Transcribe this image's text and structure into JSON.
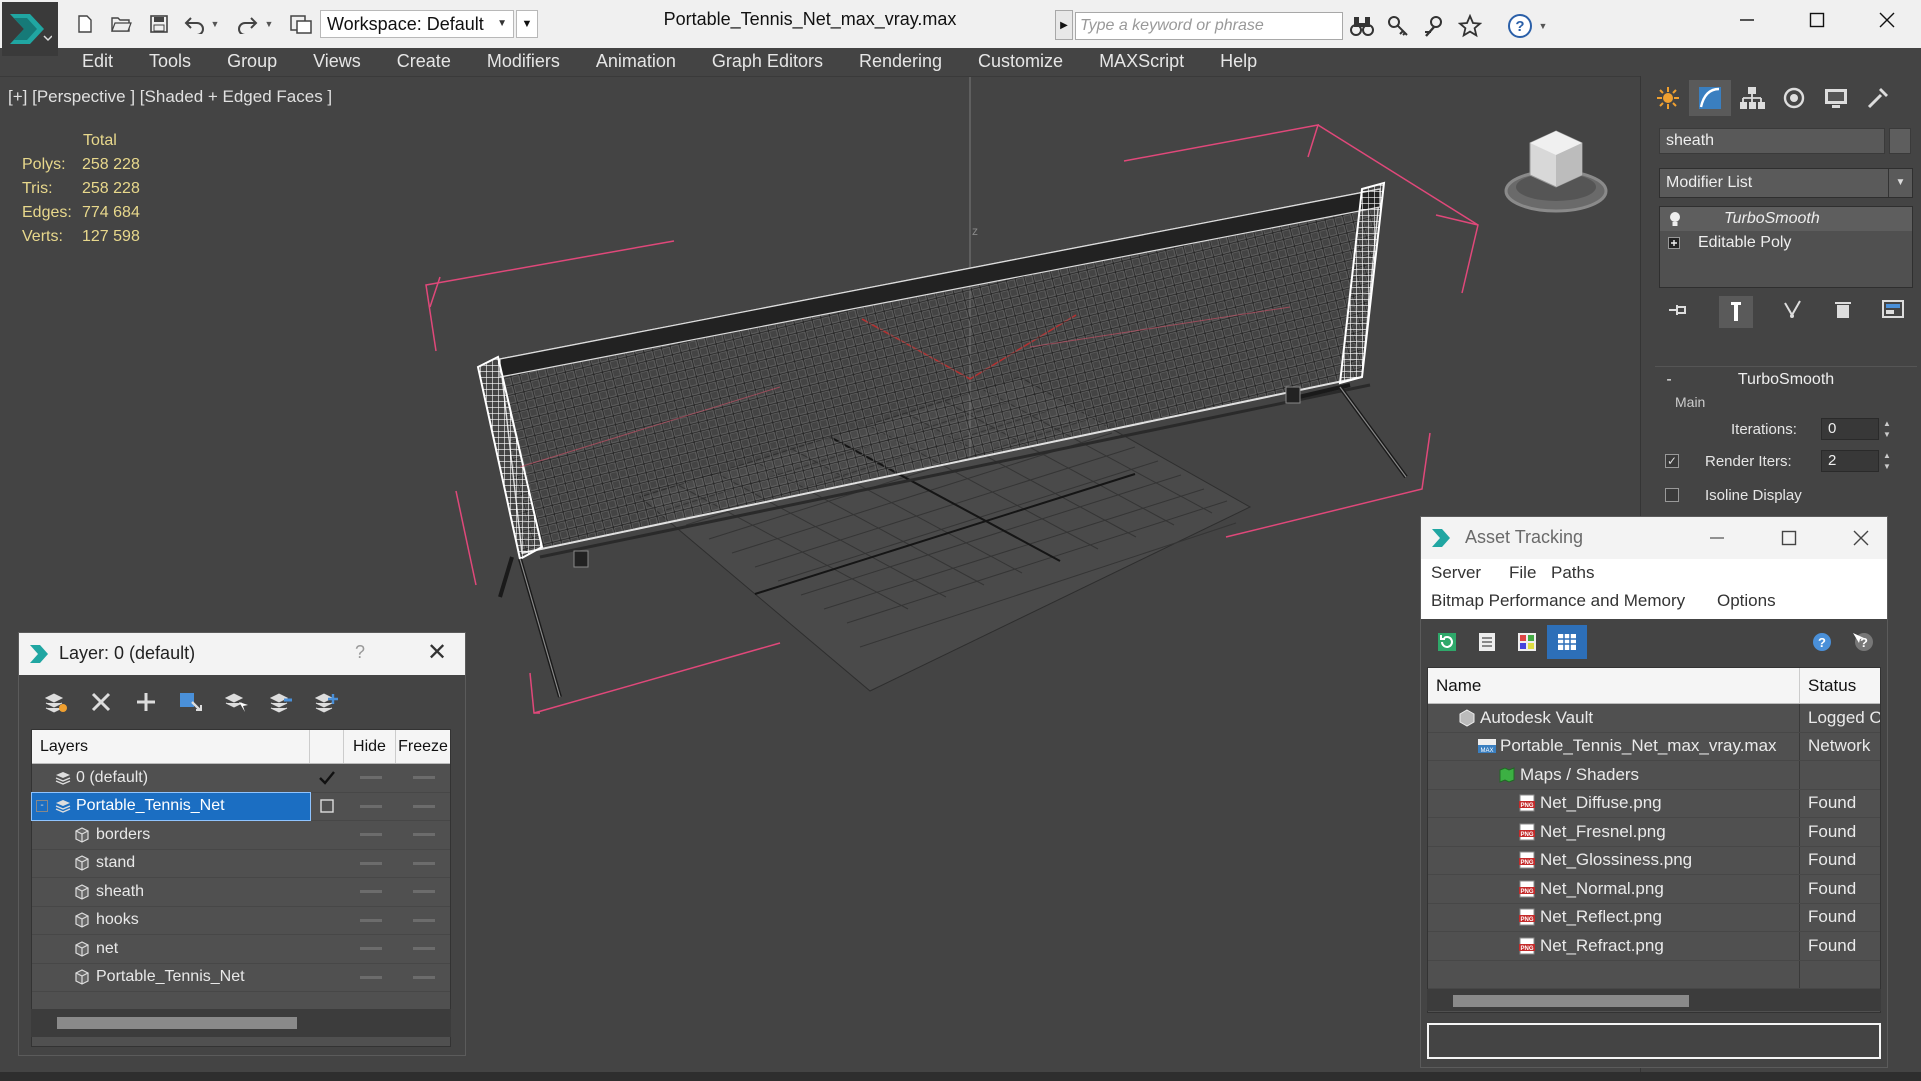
{
  "title_bar": {
    "window_title": "Portable_Tennis_Net_max_vray.max",
    "workspace_label": "Workspace: Default",
    "search_placeholder": "Type a keyword or phrase"
  },
  "menu": {
    "items": [
      "Edit",
      "Tools",
      "Group",
      "Views",
      "Create",
      "Modifiers",
      "Animation",
      "Graph Editors",
      "Rendering",
      "Customize",
      "MAXScript",
      "Help"
    ]
  },
  "viewport": {
    "label": "[+] [Perspective ] [Shaded + Edged Faces ]",
    "stats": {
      "header": "Total",
      "rows": [
        {
          "label": "Polys:",
          "value": "258 228"
        },
        {
          "label": "Tris:",
          "value": "258 228"
        },
        {
          "label": "Edges:",
          "value": "774 684"
        },
        {
          "label": "Verts:",
          "value": "127 598"
        }
      ]
    },
    "axis_label": "z",
    "colors": {
      "background": "#444444",
      "selection_brackets": "#e0487a",
      "grid": "#2a2a2a",
      "mesh": "#e8e8e8"
    }
  },
  "command_panel": {
    "object_name": "sheath",
    "modifier_list_label": "Modifier List",
    "stack": [
      {
        "label": "TurboSmooth",
        "italic": true,
        "icon": "lightbulb-icon"
      },
      {
        "label": "Editable Poly",
        "italic": false,
        "icon": "plus-box-icon"
      }
    ],
    "turbosmooth": {
      "header": "TurboSmooth",
      "collapse_symbol": "-",
      "group_label": "Main",
      "iterations_label": "Iterations:",
      "iterations_value": "0",
      "render_iters_label": "Render Iters:",
      "render_iters_value": "2",
      "render_iters_checked": true,
      "isoline_label": "Isoline Display",
      "isoline_checked": false
    }
  },
  "layer_window": {
    "title": "Layer: 0 (default)",
    "help": "?",
    "columns": {
      "layers": "Layers",
      "hide": "Hide",
      "freeze": "Freeze"
    },
    "rows": [
      {
        "name": "0 (default)",
        "indent": 0,
        "icon": "layer-stack-icon",
        "current": true,
        "selected": false,
        "expander": ""
      },
      {
        "name": "Portable_Tennis_Net",
        "indent": 0,
        "icon": "layer-stack-icon",
        "current": false,
        "selected": true,
        "expander": "-"
      },
      {
        "name": "borders",
        "indent": 1,
        "icon": "object-box-icon",
        "current": false,
        "selected": false,
        "expander": ""
      },
      {
        "name": "stand",
        "indent": 1,
        "icon": "object-box-icon",
        "current": false,
        "selected": false,
        "expander": ""
      },
      {
        "name": "sheath",
        "indent": 1,
        "icon": "object-box-icon",
        "current": false,
        "selected": false,
        "expander": ""
      },
      {
        "name": "hooks",
        "indent": 1,
        "icon": "object-box-icon",
        "current": false,
        "selected": false,
        "expander": ""
      },
      {
        "name": "net",
        "indent": 1,
        "icon": "object-box-icon",
        "current": false,
        "selected": false,
        "expander": ""
      },
      {
        "name": "Portable_Tennis_Net",
        "indent": 1,
        "icon": "object-box-icon",
        "current": false,
        "selected": false,
        "expander": ""
      }
    ]
  },
  "asset_window": {
    "title": "Asset Tracking",
    "menu_row1": [
      "Server",
      "File",
      "Paths"
    ],
    "menu_row2": [
      "Bitmap Performance and Memory",
      "Options"
    ],
    "columns": {
      "name": "Name",
      "status": "Status"
    },
    "rows": [
      {
        "name": "Autodesk Vault",
        "status": "Logged O",
        "indent": 1,
        "icon": "vault-icon"
      },
      {
        "name": "Portable_Tennis_Net_max_vray.max",
        "status": "Network",
        "indent": 2,
        "icon": "max-file-icon"
      },
      {
        "name": "Maps / Shaders",
        "status": "",
        "indent": 3,
        "icon": "maps-icon"
      },
      {
        "name": "Net_Diffuse.png",
        "status": "Found",
        "indent": 4,
        "icon": "png-file-icon"
      },
      {
        "name": "Net_Fresnel.png",
        "status": "Found",
        "indent": 4,
        "icon": "png-file-icon"
      },
      {
        "name": "Net_Glossiness.png",
        "status": "Found",
        "indent": 4,
        "icon": "png-file-icon"
      },
      {
        "name": "Net_Normal.png",
        "status": "Found",
        "indent": 4,
        "icon": "png-file-icon"
      },
      {
        "name": "Net_Reflect.png",
        "status": "Found",
        "indent": 4,
        "icon": "png-file-icon"
      },
      {
        "name": "Net_Refract.png",
        "status": "Found",
        "indent": 4,
        "icon": "png-file-icon"
      },
      {
        "name": "",
        "status": "",
        "indent": 0,
        "icon": ""
      }
    ]
  }
}
